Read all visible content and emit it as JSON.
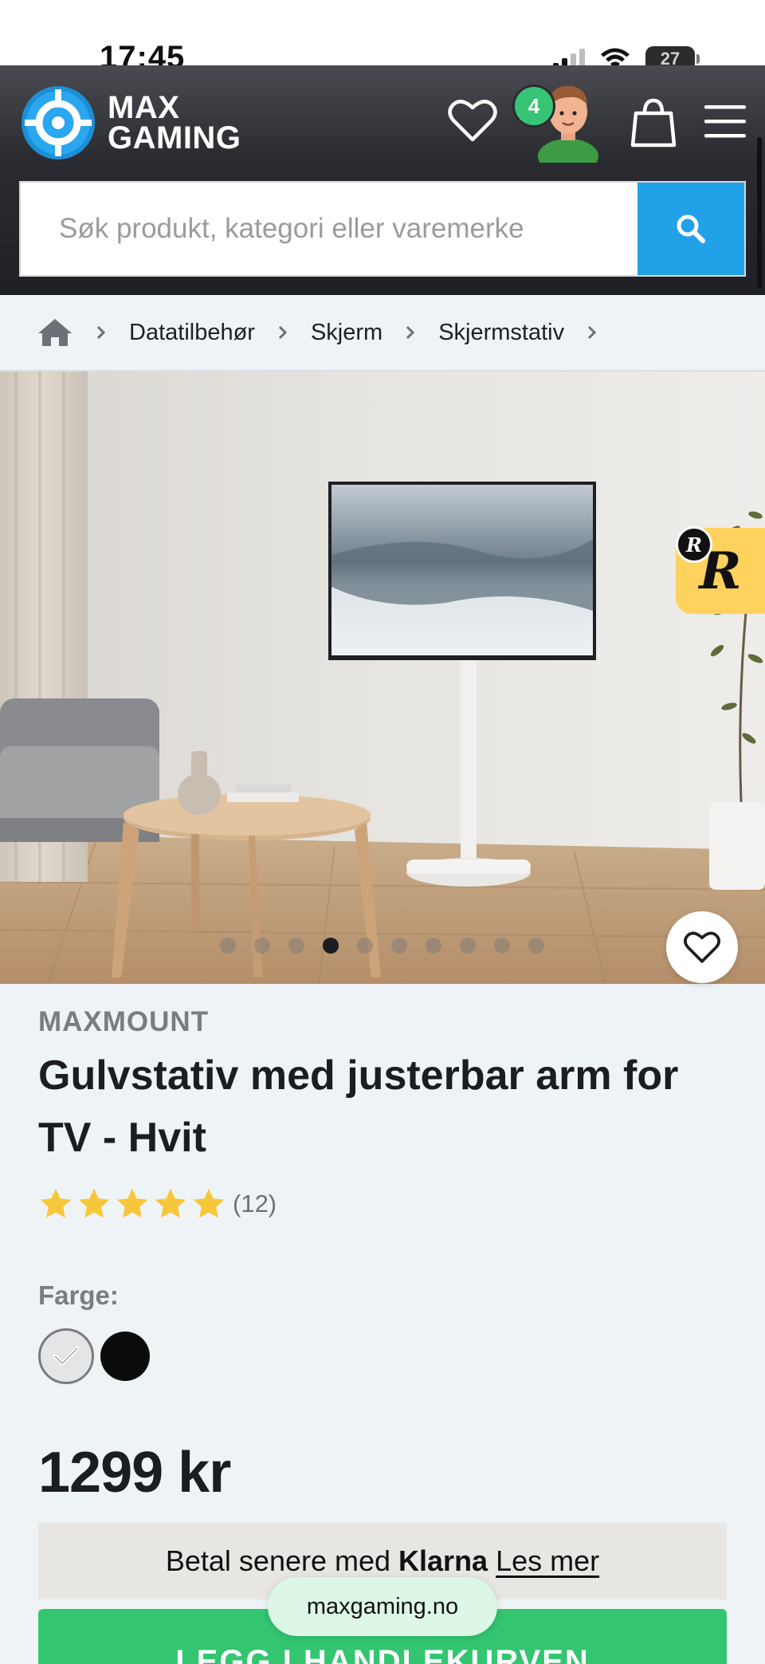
{
  "status_bar": {
    "time": "17:45",
    "battery": "27"
  },
  "header": {
    "logo_line1": "MAX",
    "logo_line2": "GAMING",
    "cart_count": "4",
    "search": {
      "placeholder": "Søk produkt, kategori eller varemerke"
    }
  },
  "breadcrumb": [
    "Datatilbehør",
    "Skjerm",
    "Skjermstativ"
  ],
  "gallery": {
    "total_images": 10,
    "active_index": 3,
    "promo_badge": "R"
  },
  "product": {
    "brand": "MAXMOUNT",
    "title": "Gulvstativ med justerbar arm for TV - Hvit",
    "rating_value": 5,
    "rating_count": "(12)",
    "color_label": "Farge:",
    "colors": [
      "white",
      "black"
    ],
    "selected_color": "white",
    "price": "1299 kr"
  },
  "klarna": {
    "text_before": "Betal senere med",
    "brand": "Klarna",
    "link": "Les mer"
  },
  "browser": {
    "domain": "maxgaming.no"
  },
  "cta": {
    "add_to_cart": "LEGG I HANDLEKURVEN"
  },
  "colors": {
    "accent_blue": "#21a1e8",
    "accent_green": "#33c570",
    "star_yellow": "#f7c73b",
    "header_dark": "#2b2c31"
  }
}
